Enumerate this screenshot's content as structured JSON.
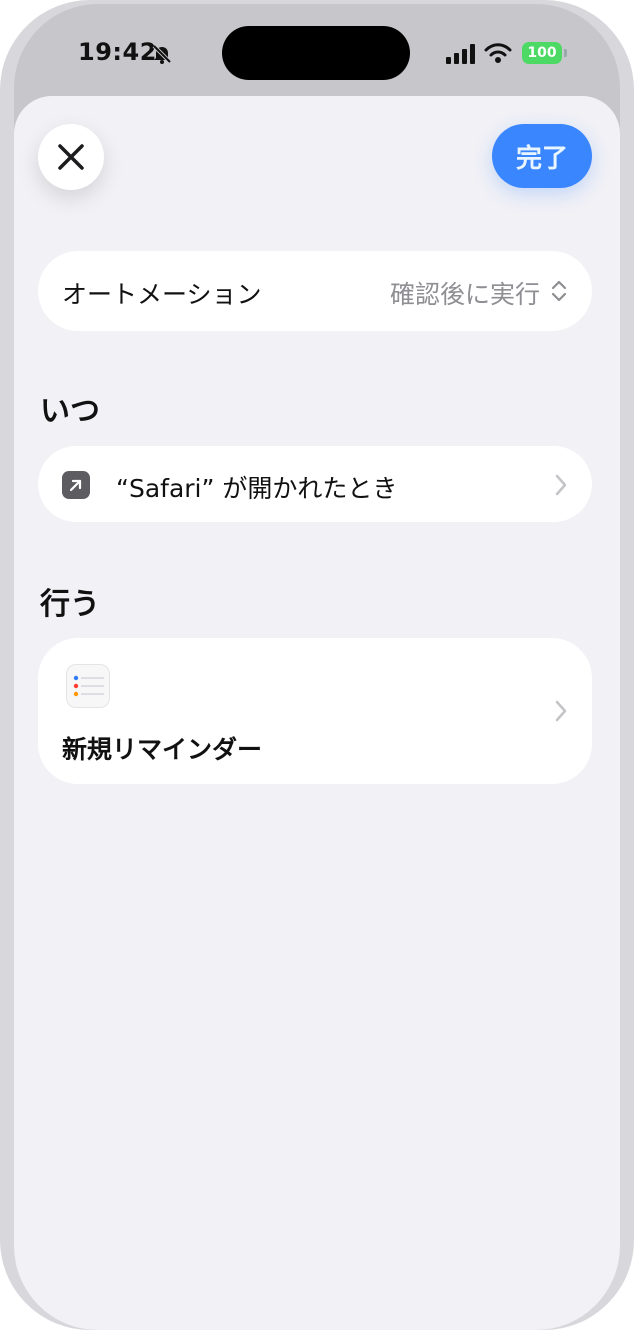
{
  "status_bar": {
    "time": "19:42",
    "battery": "100",
    "icons": [
      "bell-slash-icon",
      "cellular-signal-icon",
      "wifi-icon",
      "battery-icon"
    ]
  },
  "toolbar": {
    "close_icon": "xmark-icon",
    "done_label": "完了"
  },
  "automation": {
    "label": "オートメーション",
    "value": "確認後に実行",
    "value_icon": "chevron-up-down-icon"
  },
  "when": {
    "title": "いつ",
    "trigger_label": "“Safari” が開かれたとき",
    "trigger_icon": "app-open-arrow-icon"
  },
  "do": {
    "title": "行う",
    "action_label": "新規リマインダー",
    "action_icon": "reminders-app-icon"
  },
  "colors": {
    "accent": "#3a86ff",
    "background": "#f1f1f6",
    "card": "#ffffff",
    "secondary_text": "#8e8e93",
    "battery": "#4cd964"
  }
}
